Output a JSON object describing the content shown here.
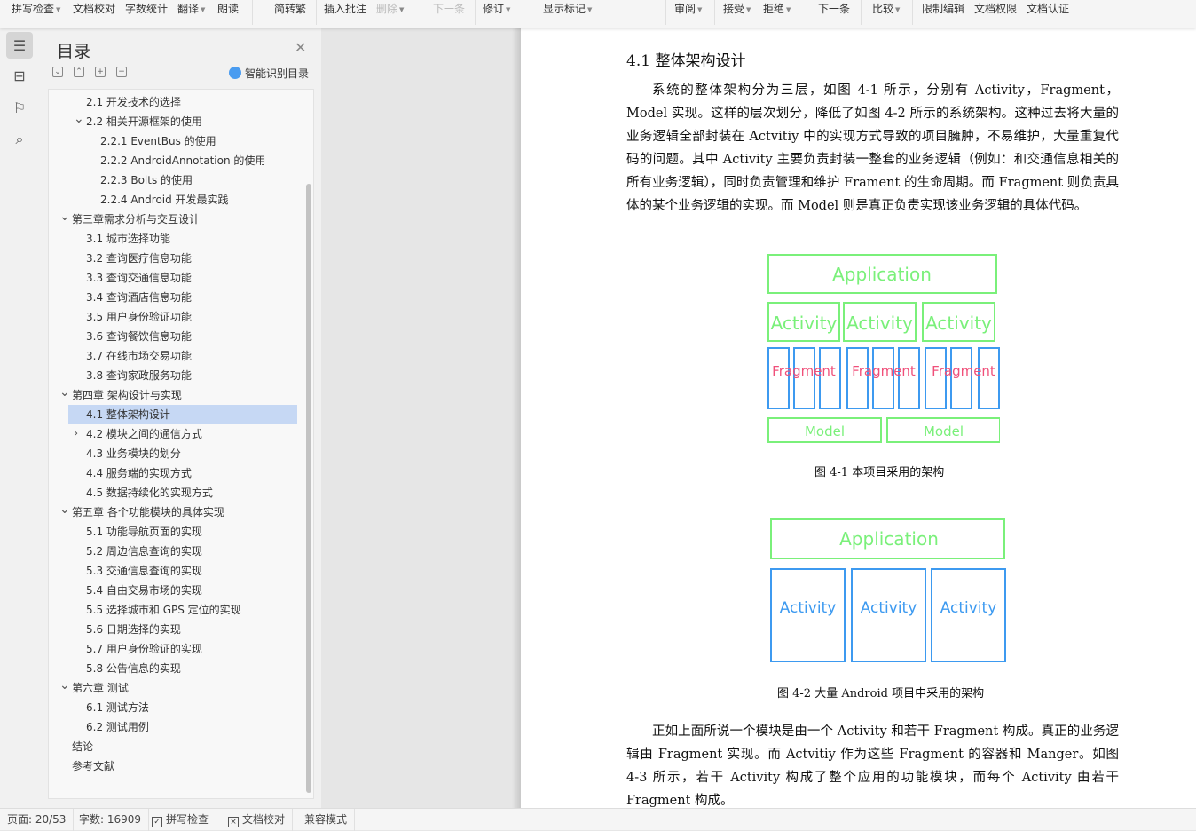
{
  "toolbar": {
    "items": [
      {
        "label": "拼写检查",
        "caret": true
      },
      {
        "label": "文档校对"
      },
      {
        "label": "字数统计"
      },
      {
        "label": "翻译",
        "caret": true
      },
      {
        "label": "朗读"
      },
      {
        "label": "简转繁"
      },
      {
        "label": "插入批注"
      },
      {
        "label": "删除",
        "caret": true,
        "disabled": true
      },
      {
        "label": "下一条",
        "disabled": true
      },
      {
        "label": "修订",
        "caret": true
      },
      {
        "label": "显示标记",
        "caret": true
      },
      {
        "label": "审阅",
        "caret": true
      },
      {
        "label": "接受",
        "caret": true
      },
      {
        "label": "拒绝",
        "caret": true
      },
      {
        "label": "下一条"
      },
      {
        "label": "比较",
        "caret": true
      },
      {
        "label": "限制编辑"
      },
      {
        "label": "文档权限"
      },
      {
        "label": "文档认证"
      }
    ]
  },
  "toc": {
    "title": "目录",
    "smart_label": "智能识别目录",
    "items": [
      {
        "label": "2.1  开发技术的选择",
        "level": 2
      },
      {
        "label": "2.2  相关开源框架的使用",
        "level": 2,
        "expanded": true
      },
      {
        "label": "2.2.1 EventBus  的使用",
        "level": 3
      },
      {
        "label": "2.2.2 AndroidAnnotation  的使用",
        "level": 3
      },
      {
        "label": "2.2.3 Bolts  的使用",
        "level": 3
      },
      {
        "label": "2.2.4 Android  开发最实践",
        "level": 3
      },
      {
        "label": "第三章需求分析与交互设计",
        "level": 1,
        "expanded": true
      },
      {
        "label": "3.1  城市选择功能",
        "level": 2
      },
      {
        "label": "3.2  查询医疗信息功能",
        "level": 2
      },
      {
        "label": "3.3  查询交通信息功能",
        "level": 2
      },
      {
        "label": "3.4  查询酒店信息功能",
        "level": 2
      },
      {
        "label": "3.5  用户身份验证功能",
        "level": 2
      },
      {
        "label": "3.6  查询餐饮信息功能",
        "level": 2
      },
      {
        "label": "3.7  在线市场交易功能",
        "level": 2
      },
      {
        "label": "3.8  查询家政服务功能",
        "level": 2
      },
      {
        "label": "第四章  架构设计与实现",
        "level": 1,
        "expanded": true
      },
      {
        "label": "4.1  整体架构设计",
        "level": 2,
        "selected": true
      },
      {
        "label": "4.2  模块之间的通信方式",
        "level": 2,
        "collapsed": true
      },
      {
        "label": "4.3  业务模块的划分",
        "level": 2
      },
      {
        "label": "4.4  服务端的实现方式",
        "level": 2
      },
      {
        "label": "4.5  数据持续化的实现方式",
        "level": 2
      },
      {
        "label": "第五章  各个功能模块的具体实现",
        "level": 1,
        "expanded": true
      },
      {
        "label": "5.1  功能导航页面的实现",
        "level": 2
      },
      {
        "label": "5.2  周边信息查询的实现",
        "level": 2
      },
      {
        "label": "5.3  交通信息查询的实现",
        "level": 2
      },
      {
        "label": "5.4  自由交易市场的实现",
        "level": 2
      },
      {
        "label": "5.5  选择城市和 GPS  定位的实现",
        "level": 2
      },
      {
        "label": "5.6  日期选择的实现",
        "level": 2
      },
      {
        "label": "5.7  用户身份验证的实现",
        "level": 2
      },
      {
        "label": "5.8 公告信息的实现",
        "level": 2
      },
      {
        "label": "第六章  测试",
        "level": 1,
        "expanded": true
      },
      {
        "label": "6.1  测试方法",
        "level": 2
      },
      {
        "label": "6.2  测试用例",
        "level": 2
      },
      {
        "label": "结论",
        "level": 1
      },
      {
        "label": "参考文献",
        "level": 1
      }
    ]
  },
  "doc": {
    "heading": "4.1  整体架构设计",
    "para1": "系统的整体架构分为三层，如图 4-1 所示，分别有 Activity，Fragment，Model 实现。这样的层次划分，降低了如图 4-2 所示的系统架构。这种过去将大量的业务逻辑全部封装在 Actvitiy 中的实现方式导致的项目臃肿，不易维护，大量重复代码的问题。其中 Activity 主要负责封装一整套的业务逻辑（例如：和交通信息相关的所有业务逻辑），同时负责管理和维护 Frament 的生命周期。而 Fragment 则负责具体的某个业务逻辑的实现。而 Model 则是真正负责实现该业务逻辑的具体代码。",
    "fig1": {
      "caption": "图 4-1  本项目采用的架构",
      "application": "Application",
      "activities": [
        "Activity",
        "Activity",
        "Activity"
      ],
      "fragments": [
        "Fragment",
        "Fragment",
        "Fragment"
      ],
      "models": [
        "Model",
        "Model"
      ]
    },
    "fig2": {
      "caption": "图 4-2  大量 Android 项目中采用的架构",
      "application": "Application",
      "activities": [
        "Activity",
        "Activity",
        "Activity"
      ]
    },
    "para2": "正如上面所说一个模块是由一个 Activity 和若干 Fragment 构成。真正的业务逻辑由 Fragment 实现。而 Actvitiy 作为这些 Fragment 的容器和 Manger。如图 4-3 所示，若干 Activity 构成了整个应用的功能模块，而每个 Activity 由若干 Fragment 构成。"
  },
  "status": {
    "page": "页面: 20/53",
    "words": "字数: 16909",
    "spell": "拼写检查",
    "proof": "文档校对",
    "compat": "兼容模式"
  },
  "colors": {
    "green": "#7af07a",
    "blue": "#3d9af0",
    "pink": "#f0507a",
    "selected": "#c6d8f4"
  }
}
